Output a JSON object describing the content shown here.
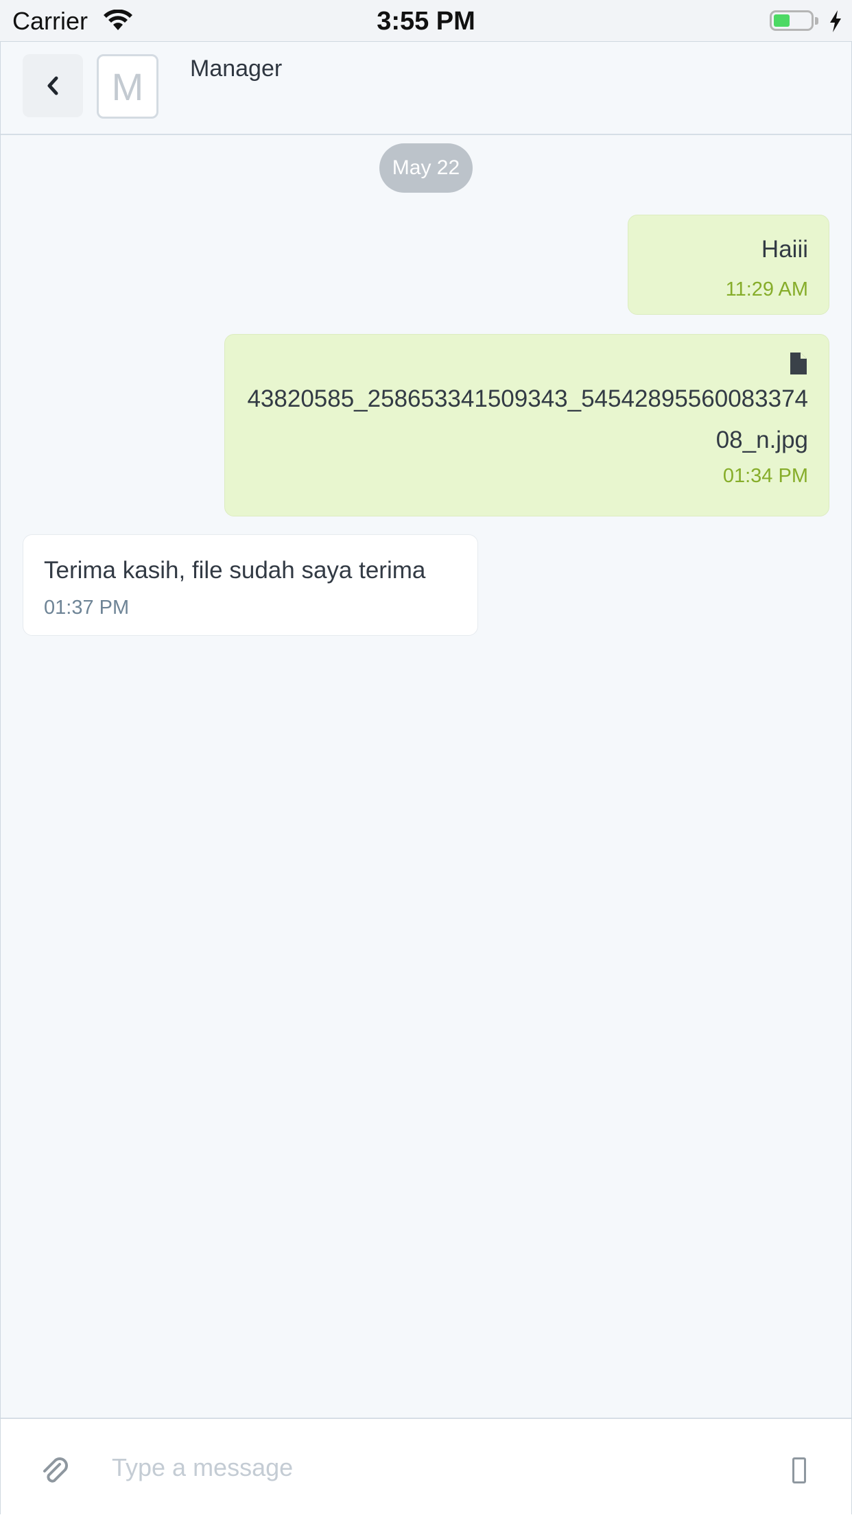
{
  "status_bar": {
    "carrier": "Carrier",
    "time": "3:55 PM",
    "battery_level": 0.45,
    "battery_color": "#4cd964"
  },
  "header": {
    "back_icon": "chevron-left-icon",
    "avatar_initial": "M",
    "contact_name": "Manager"
  },
  "conversation": {
    "date_label": "May 22",
    "messages": [
      {
        "direction": "outgoing",
        "text": "Haiii",
        "time": "11:29 AM"
      },
      {
        "direction": "outgoing",
        "type": "file",
        "icon": "file-icon",
        "text": "43820585_258653341509343_5454289556008337408_n.jpg",
        "time": "01:34 PM"
      },
      {
        "direction": "incoming",
        "text": "Terima kasih, file sudah saya terima",
        "time": "01:37 PM"
      }
    ]
  },
  "composer": {
    "placeholder": "Type a message",
    "value": "",
    "attach_icon": "paperclip-icon",
    "send_icon": "send-icon"
  },
  "colors": {
    "outgoing_bubble": "#e8f6cf",
    "outgoing_time": "#86ad2a",
    "incoming_time": "#6e8496",
    "background": "#f5f8fb"
  }
}
